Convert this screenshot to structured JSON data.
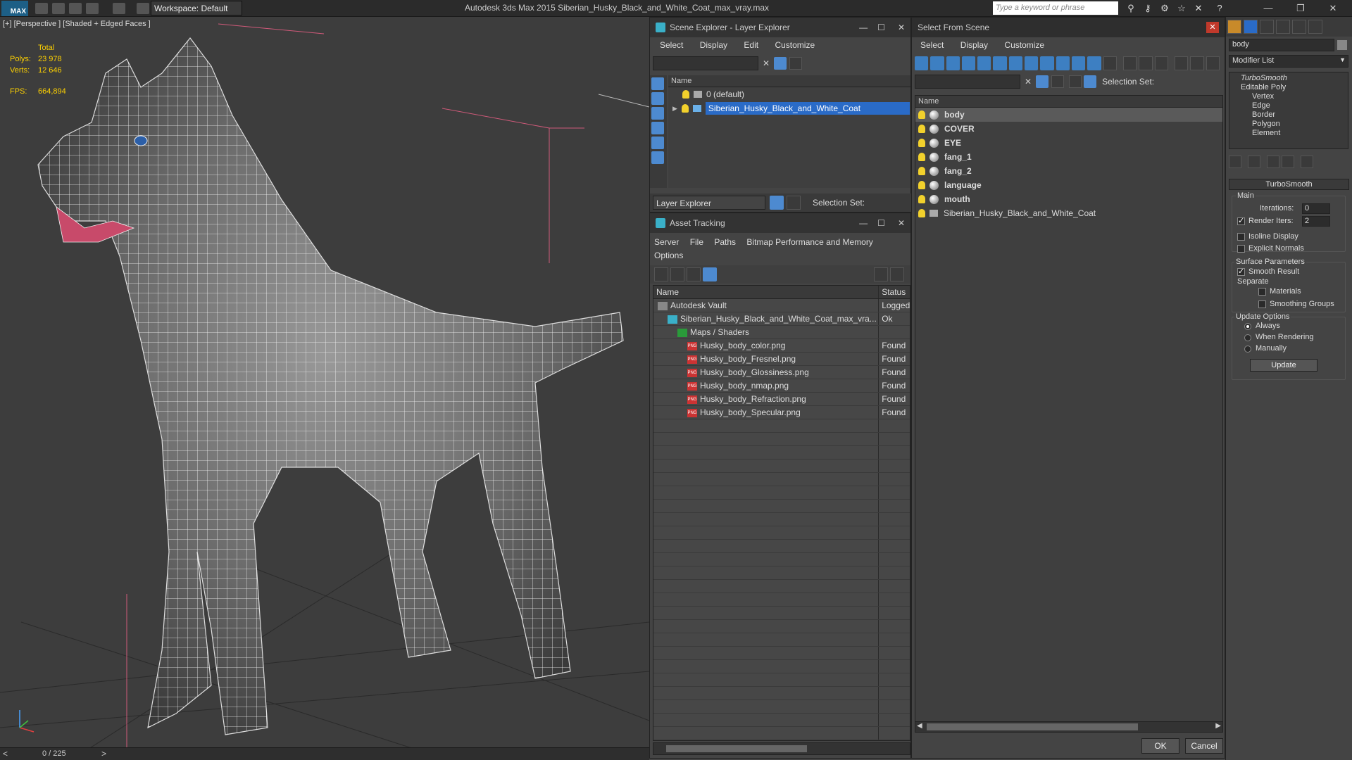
{
  "titlebar": {
    "workspace": "Workspace: Default",
    "app_title": "Autodesk 3ds Max  2015    Siberian_Husky_Black_and_White_Coat_max_vray.max",
    "search_placeholder": "Type a keyword or phrase"
  },
  "viewport": {
    "label": "[+] [Perspective ] [Shaded + Edged Faces ]",
    "stats": {
      "total_label": "Total",
      "polys_label": "Polys:",
      "polys_value": "23 978",
      "verts_label": "Verts:",
      "verts_value": "12 646",
      "fps_label": "FPS:",
      "fps_value": "664,894"
    },
    "frame_counter": "0 / 225"
  },
  "scene_explorer": {
    "title": "Scene Explorer - Layer Explorer",
    "menu": [
      "Select",
      "Display",
      "Edit",
      "Customize"
    ],
    "column_name": "Name",
    "layers": [
      "0 (default)",
      "Siberian_Husky_Black_and_White_Coat"
    ],
    "footer_mode": "Layer Explorer",
    "footer_selection_set": "Selection Set:"
  },
  "asset_tracking": {
    "title": "Asset Tracking",
    "menu": [
      "Server",
      "File",
      "Paths",
      "Bitmap Performance and Memory",
      "Options"
    ],
    "col_name": "Name",
    "col_status": "Status",
    "rows": [
      {
        "name": "Autodesk Vault",
        "status": "Logged",
        "indent": 0,
        "kind": "vault"
      },
      {
        "name": "Siberian_Husky_Black_and_White_Coat_max_vra...",
        "status": "Ok",
        "indent": 1,
        "kind": "max"
      },
      {
        "name": "Maps / Shaders",
        "status": "",
        "indent": 2,
        "kind": "maps"
      },
      {
        "name": "Husky_body_color.png",
        "status": "Found",
        "indent": 3,
        "kind": "png"
      },
      {
        "name": "Husky_body_Fresnel.png",
        "status": "Found",
        "indent": 3,
        "kind": "png"
      },
      {
        "name": "Husky_body_Glossiness.png",
        "status": "Found",
        "indent": 3,
        "kind": "png"
      },
      {
        "name": "Husky_body_nmap.png",
        "status": "Found",
        "indent": 3,
        "kind": "png"
      },
      {
        "name": "Husky_body_Refraction.png",
        "status": "Found",
        "indent": 3,
        "kind": "png"
      },
      {
        "name": "Husky_body_Specular.png",
        "status": "Found",
        "indent": 3,
        "kind": "png"
      }
    ]
  },
  "select_from_scene": {
    "title": "Select From Scene",
    "menu": [
      "Select",
      "Display",
      "Customize"
    ],
    "selection_set_label": "Selection Set:",
    "column_name": "Name",
    "objects": [
      "body",
      "COVER",
      "EYE",
      "fang_1",
      "fang_2",
      "language",
      "mouth",
      "Siberian_Husky_Black_and_White_Coat"
    ],
    "ok_label": "OK",
    "cancel_label": "Cancel"
  },
  "command_panel": {
    "object_name": "body",
    "modifier_list": "Modifier List",
    "stack": [
      "TurboSmooth",
      "Editable Poly",
      "Vertex",
      "Edge",
      "Border",
      "Polygon",
      "Element"
    ],
    "rollout_title": "TurboSmooth",
    "main_label": "Main",
    "iterations_label": "Iterations:",
    "iterations_value": "0",
    "render_iters_label": "Render Iters:",
    "render_iters_value": "2",
    "isoline_label": "Isoline Display",
    "explicit_normals_label": "Explicit Normals",
    "surface_params_label": "Surface Parameters",
    "smooth_result_label": "Smooth Result",
    "separate_label": "Separate",
    "materials_label": "Materials",
    "smoothing_groups_label": "Smoothing Groups",
    "update_options_label": "Update Options",
    "always_label": "Always",
    "when_rendering_label": "When Rendering",
    "manually_label": "Manually",
    "update_button": "Update"
  }
}
